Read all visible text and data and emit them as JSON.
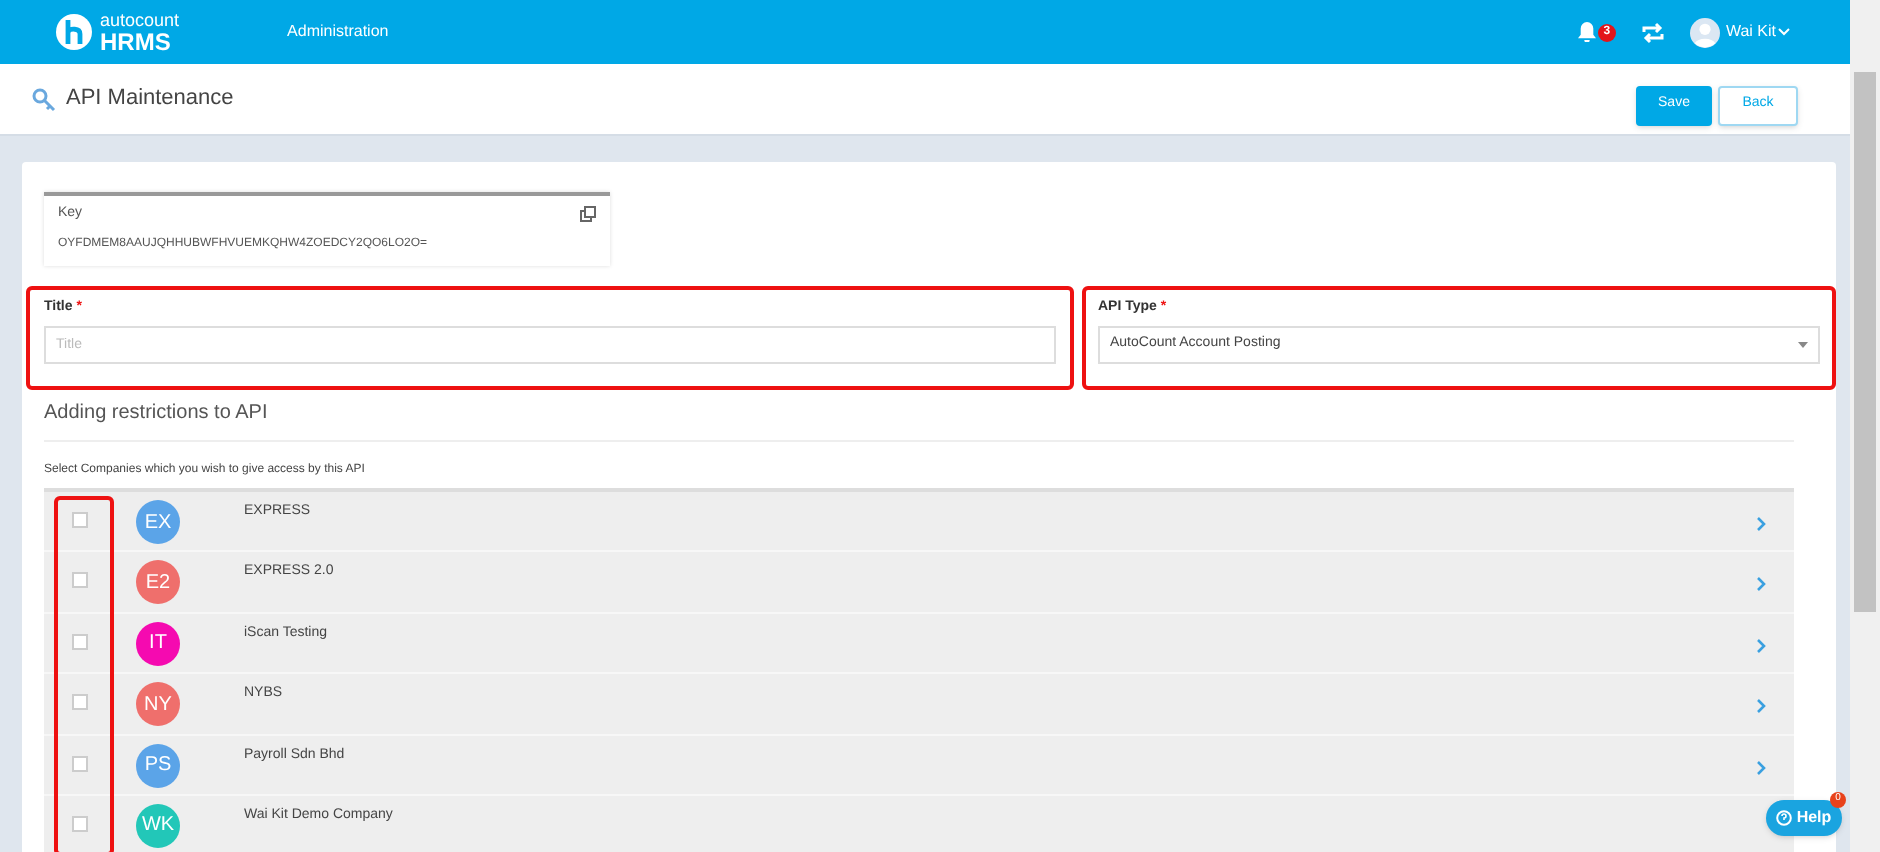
{
  "header": {
    "logo_top": "autocount",
    "logo_bottom": "HRMS",
    "nav": "Administration",
    "notifications": "3",
    "user": "Wai Kit"
  },
  "page": {
    "title": "API Maintenance",
    "buttons": [
      "Save",
      "Back"
    ]
  },
  "key": {
    "label": "Key",
    "value": "OYFDMEM8AAUJQHHUBWFHVUEMKQHW4ZOEDCY2QO6LO2O="
  },
  "title_field": {
    "label": "Title",
    "required": "*",
    "placeholder": "Title"
  },
  "api_type": {
    "label": "API Type",
    "required": "*",
    "value": "AutoCount Account Posting"
  },
  "section_heading": "Adding restrictions to API",
  "companies_hint": "Select Companies which you wish to give access by this API",
  "companies": [
    {
      "initials": "EX",
      "name": "EXPRESS",
      "color": "#5ba4e8",
      "checked": false
    },
    {
      "initials": "E2",
      "name": "EXPRESS 2.0",
      "color": "#ef6f6c",
      "checked": false
    },
    {
      "initials": "IT",
      "name": "iScan Testing",
      "color": "#f50ab0",
      "checked": false
    },
    {
      "initials": "NY",
      "name": "NYBS",
      "color": "#ef6f6c",
      "checked": false
    },
    {
      "initials": "PS",
      "name": "Payroll Sdn Bhd",
      "color": "#5ba4e8",
      "checked": false
    },
    {
      "initials": "WK",
      "name": "Wai Kit Demo Company",
      "color": "#22c7b8",
      "checked": false
    }
  ],
  "help": {
    "label": "Help",
    "badge": "0"
  }
}
